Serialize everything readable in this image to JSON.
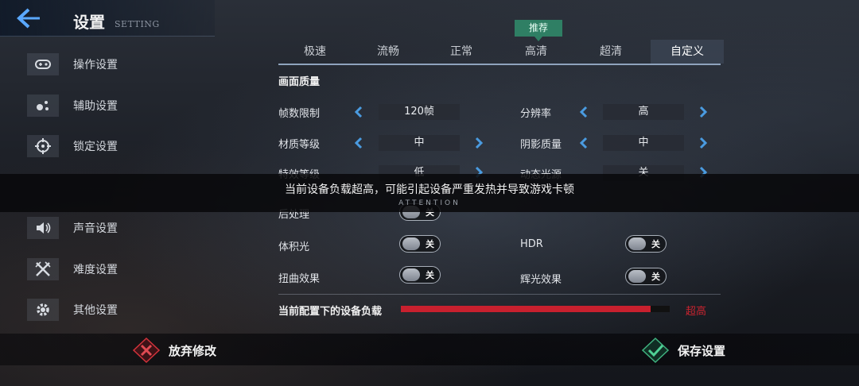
{
  "header": {
    "title": "设置",
    "subtitle": "SETTING",
    "back_icon": "back-arrow-icon"
  },
  "sidebar": {
    "items": [
      {
        "label": "操作设置",
        "icon": "gamepad-icon"
      },
      {
        "label": "辅助设置",
        "icon": "assist-dots-icon"
      },
      {
        "label": "锁定设置",
        "icon": "crosshair-icon"
      },
      {
        "label": "声音设置",
        "icon": "speaker-icon"
      },
      {
        "label": "难度设置",
        "icon": "crossed-swords-icon"
      },
      {
        "label": "其他设置",
        "icon": "gear-icon"
      }
    ]
  },
  "quality_tabs": {
    "items": [
      "极速",
      "流畅",
      "正常",
      "高清",
      "超清",
      "自定义"
    ],
    "selected": "自定义",
    "recommended_badge": "推荐"
  },
  "section": {
    "title": "画面质量"
  },
  "settings": {
    "fps": {
      "label": "帧数限制",
      "value": "120帧"
    },
    "resolution": {
      "label": "分辨率",
      "value": "高"
    },
    "texture": {
      "label": "材质等级",
      "value": "中"
    },
    "shadow": {
      "label": "阴影质量",
      "value": "中"
    },
    "effects": {
      "label": "特效等级",
      "value": "低"
    },
    "dynamic_light": {
      "label": "动态光源",
      "value": "关"
    },
    "post_process": {
      "label": "后处理",
      "value": "关"
    },
    "volumetric": {
      "label": "体积光",
      "value": "关"
    },
    "hdr": {
      "label": "HDR",
      "value": "关"
    },
    "distortion": {
      "label": "扭曲效果",
      "value": "关"
    },
    "glow": {
      "label": "辉光效果",
      "value": "关"
    }
  },
  "load": {
    "label": "当前配置下的设备负载",
    "status": "超高",
    "level": 0.93,
    "color": "#c8202e"
  },
  "footer": {
    "discard_label": "放弃修改",
    "save_label": "保存设置"
  },
  "toast": {
    "message": "当前设备负载超高，可能引起设备严重发热并导致游戏卡顿",
    "sub": "ATTENTION"
  },
  "colors": {
    "accent": "#4a9be0",
    "recommend": "#2f7f64",
    "danger": "#c8202e",
    "confirm": "#3fb27f"
  }
}
